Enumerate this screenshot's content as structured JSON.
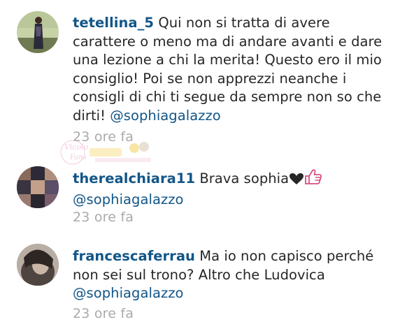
{
  "comments": [
    {
      "username": "tetellina_5",
      "text": "Qui non si tratta di avere carattere o meno ma di andare avanti e dare una lezione a chi la merita! Questo ero il mio consiglio! Poi se non apprezzi neanche i consigli di chi ti segue da sempre non so che dirti!",
      "mention": "@sophiagalazzo",
      "time": "23 ore fa"
    },
    {
      "username": "therealchiara11",
      "text": "Brava sophia",
      "emojis": [
        "black-heart",
        "thumbs-up"
      ],
      "mention": "@sophiagalazzo",
      "time": "23 ore fa"
    },
    {
      "username": "francescaferrau",
      "text": "Ma io non capisco perché non sei sul trono? Altro che Ludovica",
      "mention": "@sophiagalazzo",
      "time": "23 ore fa"
    }
  ],
  "watermark": {
    "script": "Vicolo Fans",
    "colors": {
      "pink": "#e8a4c8",
      "yellow": "#f2d35b"
    }
  },
  "colors": {
    "username": "#125688",
    "text": "#262626",
    "time": "#aaaaaa",
    "thumb": "#d64f86"
  }
}
